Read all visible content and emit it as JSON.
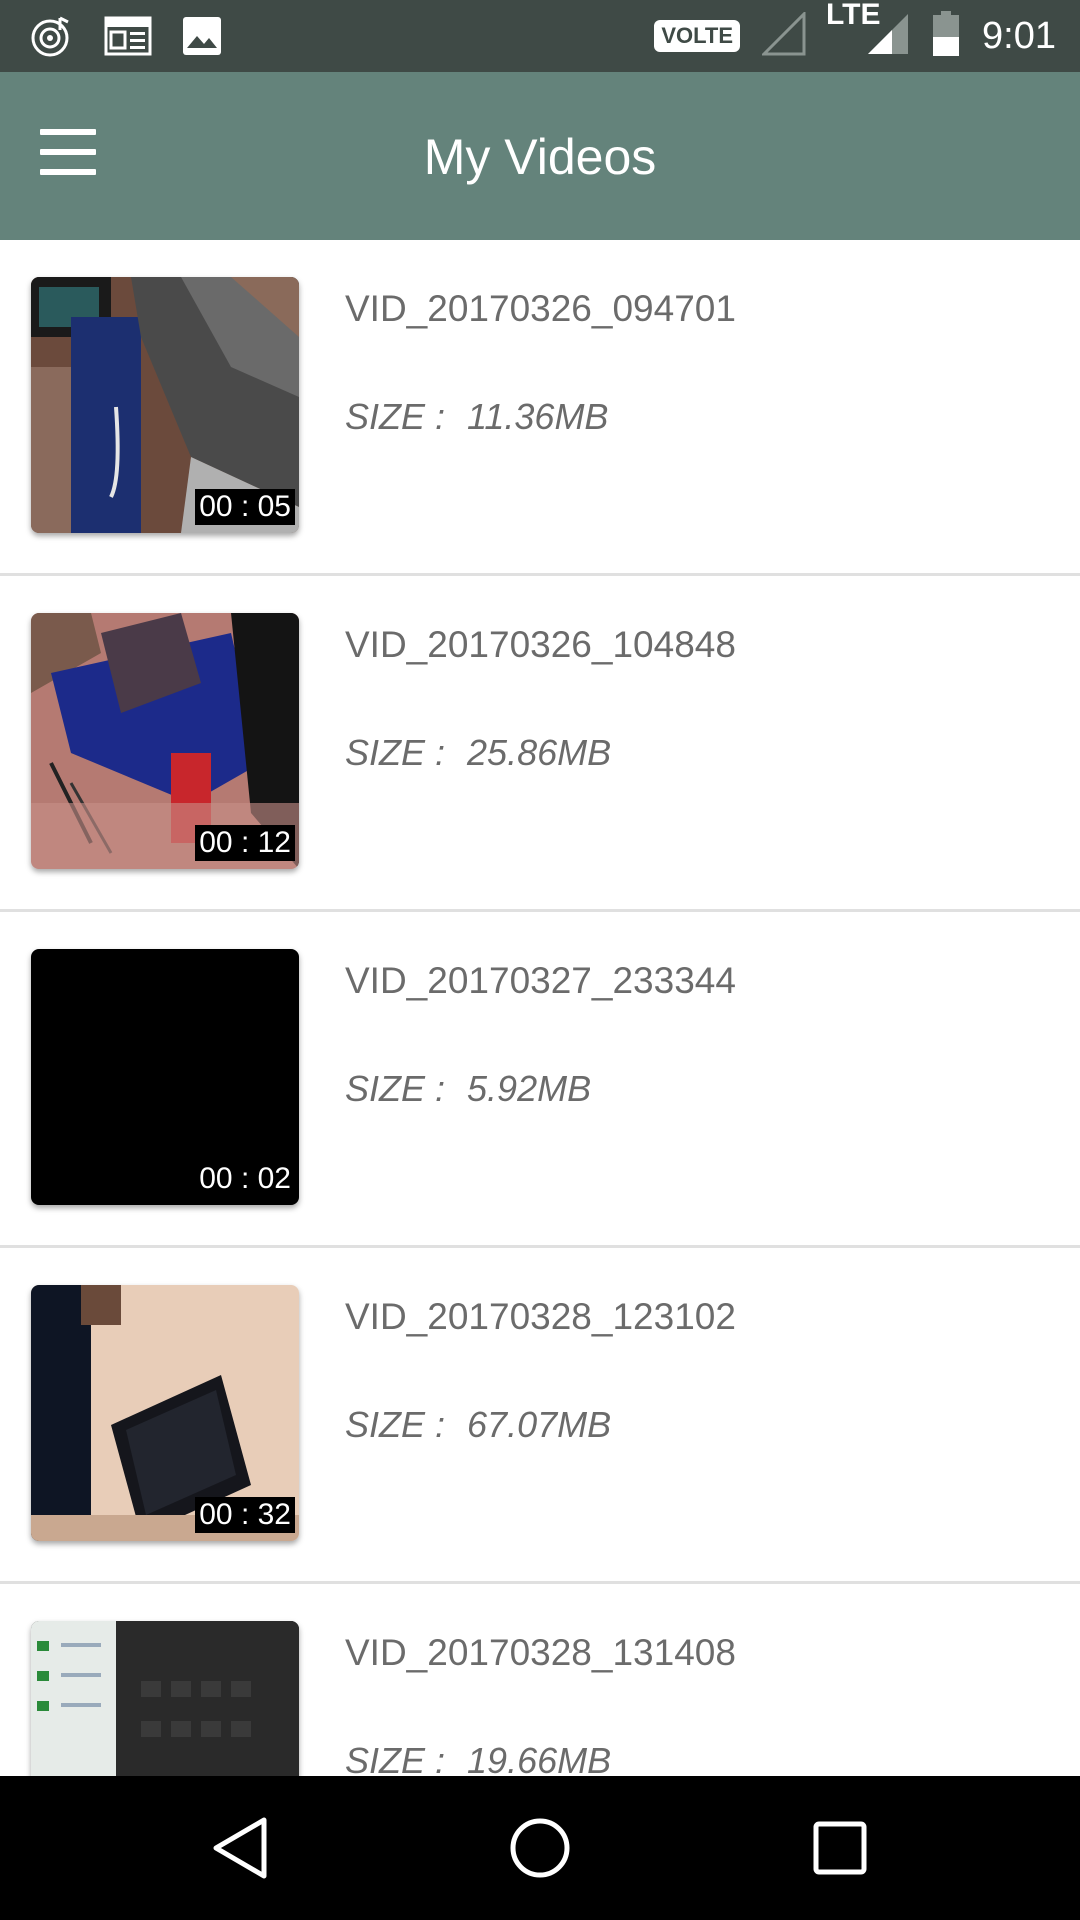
{
  "status_bar": {
    "volte": "VOLTE",
    "lte": "LTE",
    "time": "9:01",
    "icons": [
      "music-icon",
      "news-icon",
      "image-icon",
      "signal-icon",
      "signal-lte-icon",
      "battery-icon"
    ]
  },
  "app_bar": {
    "title": "My Videos",
    "menu_icon": "hamburger-menu-icon"
  },
  "videos": [
    {
      "name": "VID_20170326_094701",
      "size_label": "SIZE :",
      "size": "11.36MB",
      "duration": "00 : 05"
    },
    {
      "name": "VID_20170326_104848",
      "size_label": "SIZE :",
      "size": "25.86MB",
      "duration": "00 : 12"
    },
    {
      "name": "VID_20170327_233344",
      "size_label": "SIZE :",
      "size": "5.92MB",
      "duration": "00 : 02"
    },
    {
      "name": "VID_20170328_123102",
      "size_label": "SIZE :",
      "size": "67.07MB",
      "duration": "00 : 32"
    },
    {
      "name": "VID_20170328_131408",
      "size_label": "SIZE :",
      "size": "19.66MB",
      "duration": ""
    }
  ],
  "nav_bar": {
    "icons": [
      "back-icon",
      "home-icon",
      "recents-icon"
    ]
  },
  "colors": {
    "status_bar": "#3f4a46",
    "app_bar": "#64837b",
    "text_secondary": "#6b6b6b"
  }
}
